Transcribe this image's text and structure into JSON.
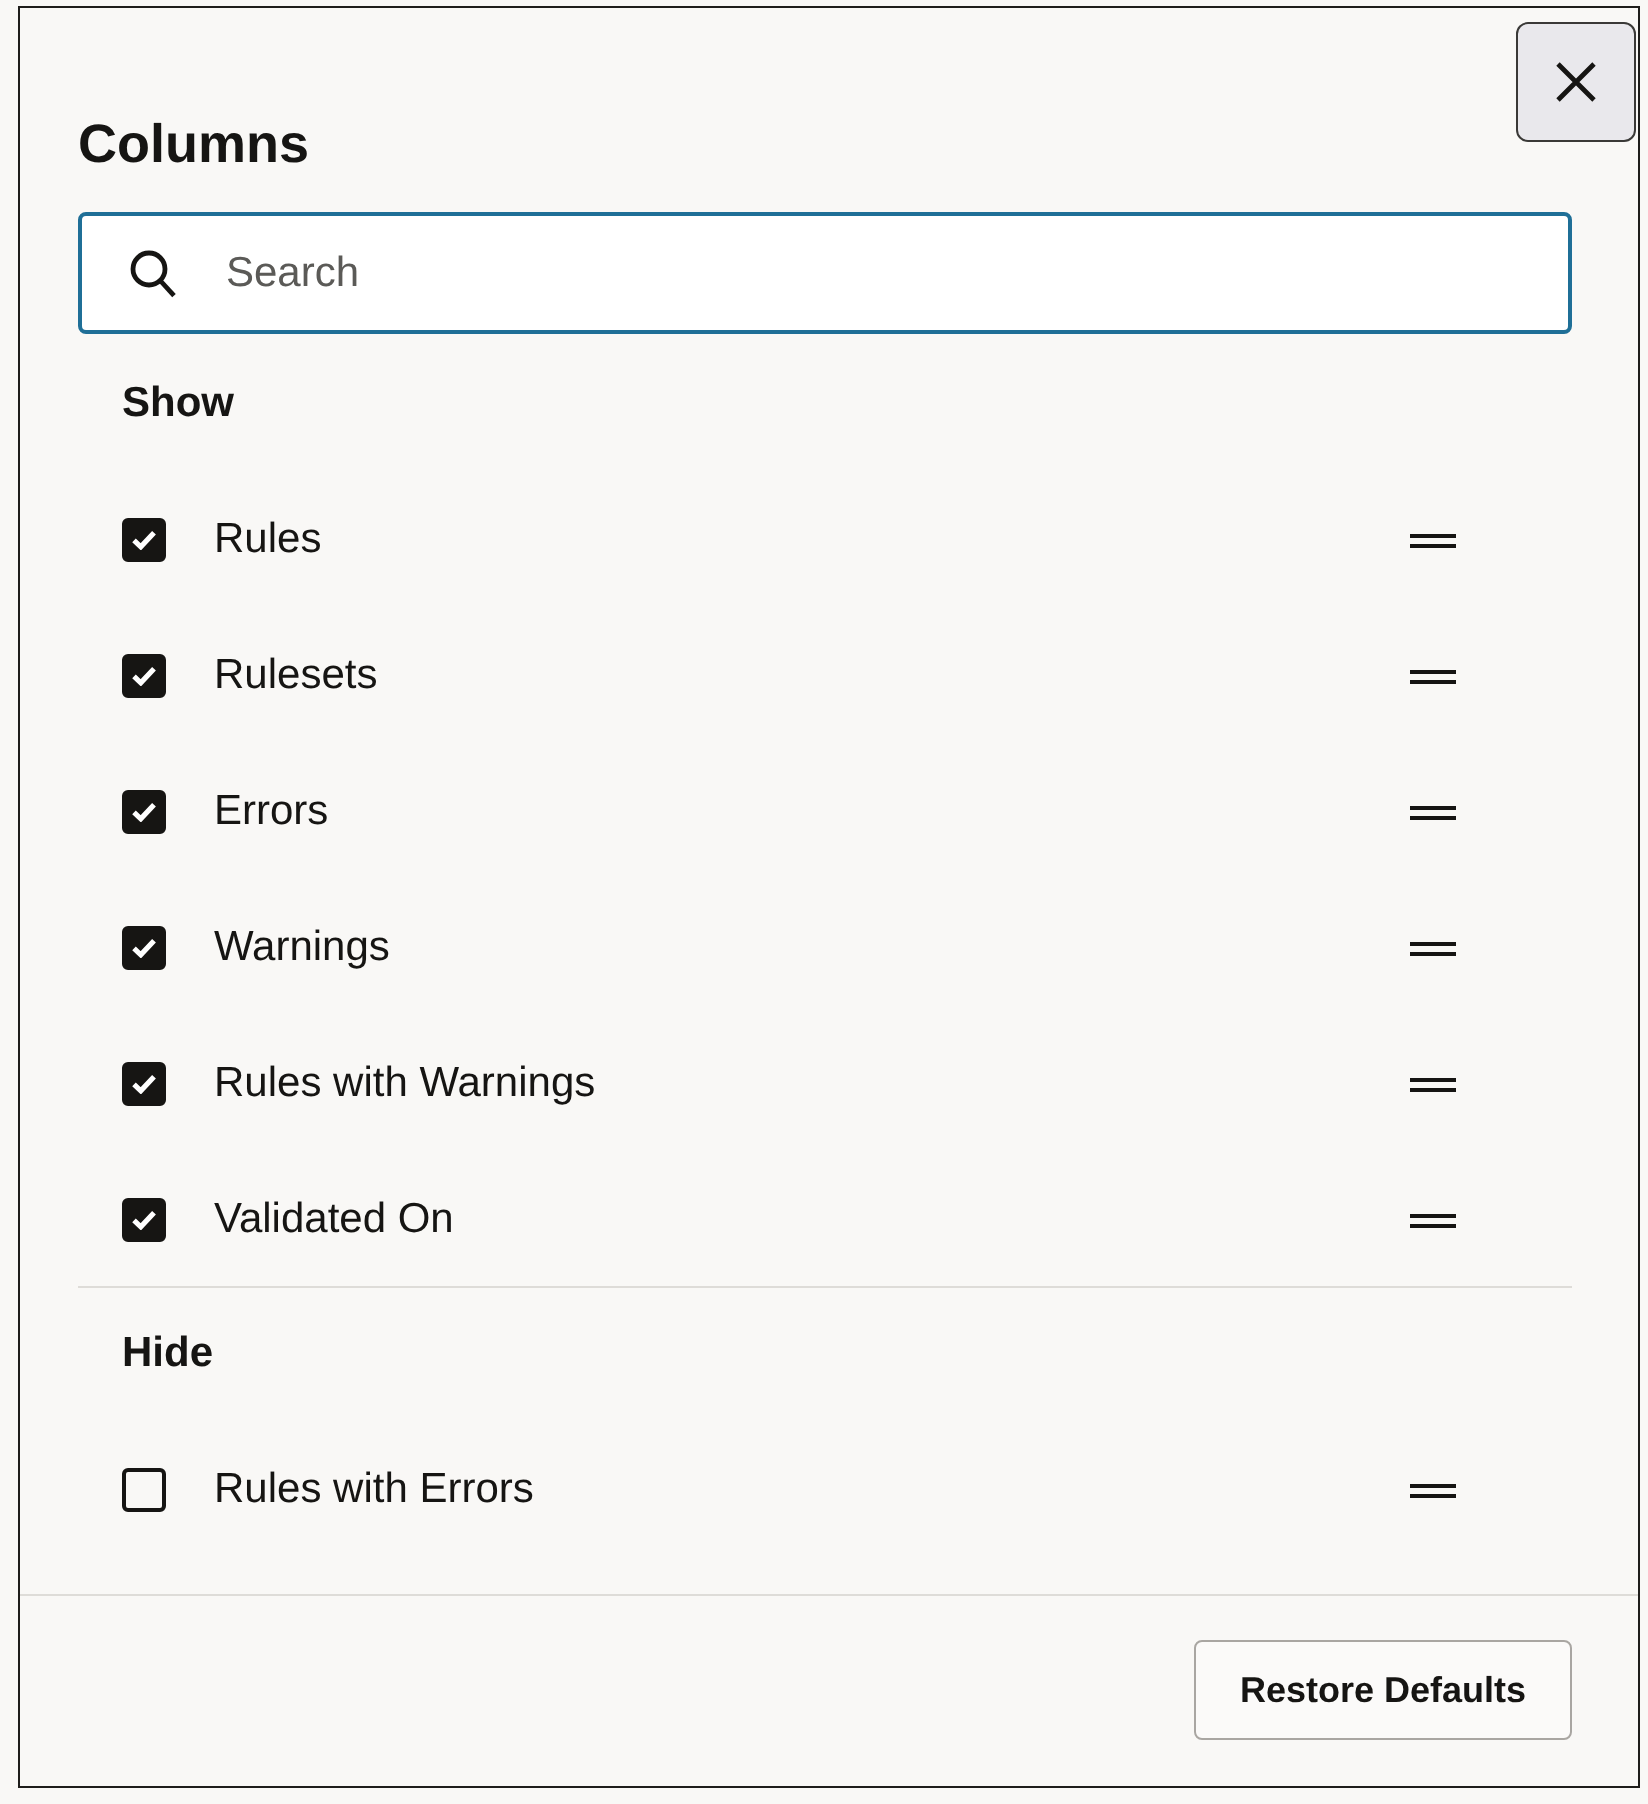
{
  "dialog": {
    "title": "Columns"
  },
  "search": {
    "placeholder": "Search"
  },
  "sections": [
    {
      "heading": "Show",
      "columns": [
        {
          "label": "Rules",
          "checked": true
        },
        {
          "label": "Rulesets",
          "checked": true
        },
        {
          "label": "Errors",
          "checked": true
        },
        {
          "label": "Warnings",
          "checked": true
        },
        {
          "label": "Rules with Warnings",
          "checked": true
        },
        {
          "label": "Validated On",
          "checked": true
        }
      ]
    },
    {
      "heading": "Hide",
      "columns": [
        {
          "label": "Rules with Errors",
          "checked": false
        }
      ]
    }
  ],
  "footer": {
    "buttons": [
      "Restore Defaults"
    ]
  }
}
